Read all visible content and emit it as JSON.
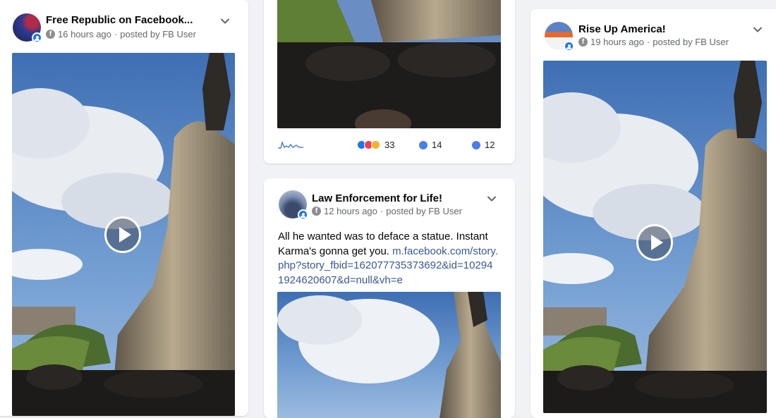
{
  "posts": [
    {
      "page_name": "Free Republic on Facebook...",
      "time": "16 hours ago",
      "posted_by": "posted by FB User"
    },
    {
      "stats": {
        "reactions": "33",
        "comments": "14",
        "shares": "12"
      }
    },
    {
      "page_name": "Law Enforcement for Life!",
      "time": "12 hours ago",
      "posted_by": "posted by FB User",
      "text": "All he wanted was to deface a statue. Instant Karma's gonna get you.",
      "link": "m.facebook.com/story.php?story_fbid=162077735373692&id=102941924620607&d=null&vh=e"
    },
    {
      "page_name": "Rise Up America!",
      "time": "19 hours ago",
      "posted_by": "posted by FB User"
    }
  ],
  "icons": {
    "facebook": "facebook-icon",
    "chevron": "chevron-down-icon",
    "play": "play-icon",
    "group_badge": "group-badge-icon"
  },
  "colors": {
    "background": "#f0f2f5",
    "link": "#385898",
    "brand": "#1877f2",
    "meta": "#65676b"
  }
}
